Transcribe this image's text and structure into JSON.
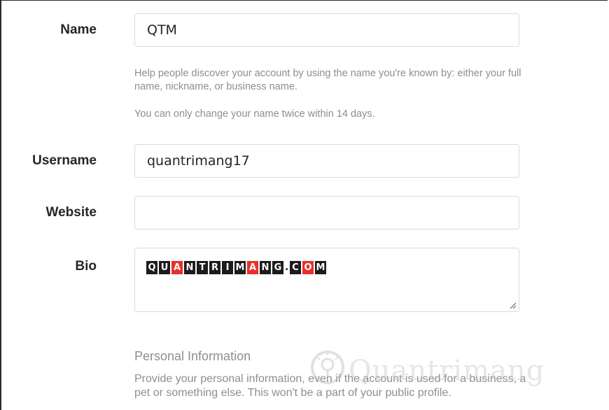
{
  "fields": {
    "name": {
      "label": "Name",
      "value": "QTM",
      "help_1": "Help people discover your account by using the name you're known by: either your full name, nickname, or business name.",
      "help_2": "You can only change your name twice within 14 days."
    },
    "username": {
      "label": "Username",
      "value": "quantrimang17"
    },
    "website": {
      "label": "Website",
      "value": ""
    },
    "bio": {
      "label": "Bio",
      "value": "QUANTRIMANG.COM"
    }
  },
  "personal_info": {
    "title": "Personal Information",
    "description": "Provide your personal information, even if the account is used for a business, a pet or something else. This won't be a part of your public profile."
  },
  "watermark": {
    "text": "Quantrimang",
    "icon": "lightbulb-icon"
  },
  "colors": {
    "label": "#262626",
    "help": "#8e8e8e",
    "border": "#dbdbdb",
    "logo_dark": "#1c1c1c",
    "logo_red": "#e8302a"
  }
}
